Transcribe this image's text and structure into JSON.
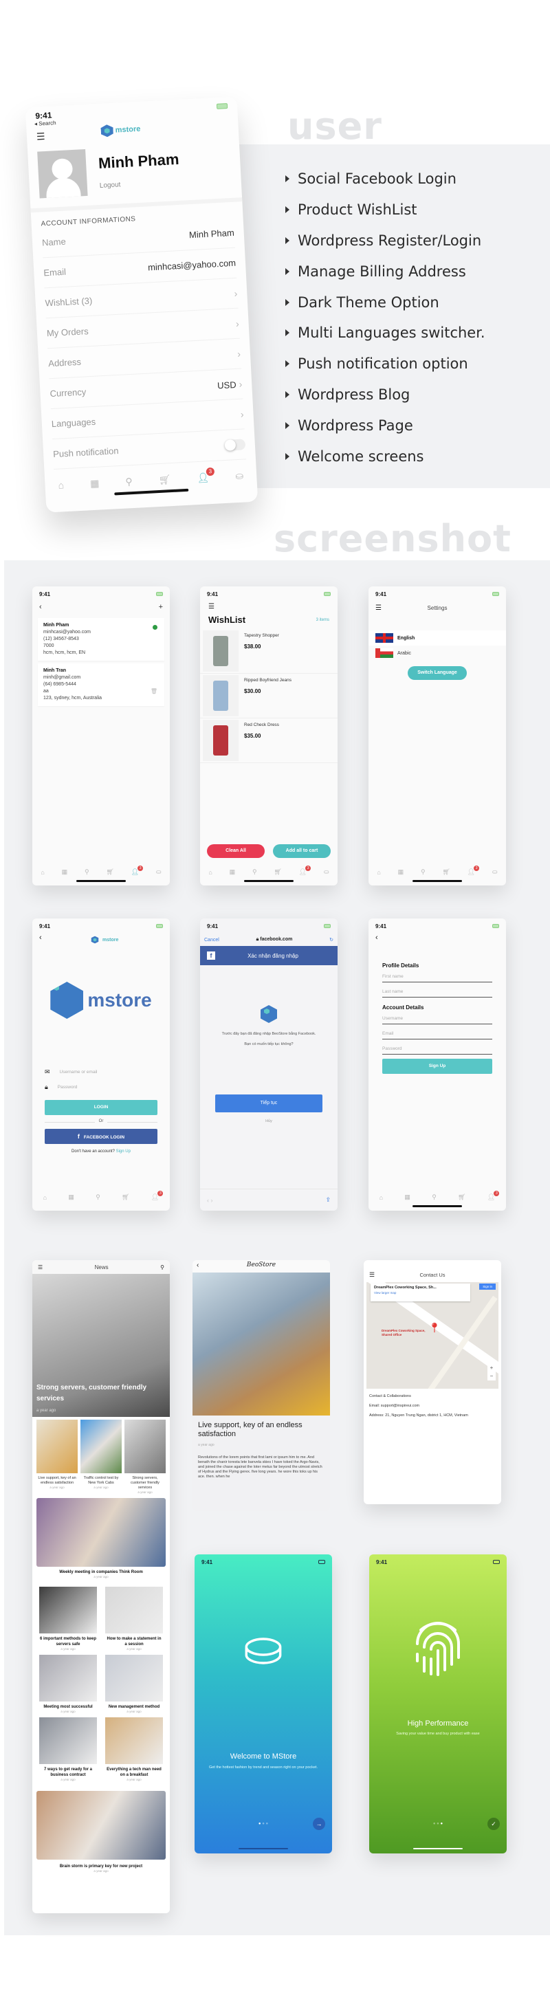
{
  "sections": {
    "user_title": "user",
    "screenshot_title": "screenshot"
  },
  "features": [
    "Social Facebook Login",
    "Product WishList",
    "Wordpress Register/Login",
    "Manage Billing Address",
    "Dark Theme Option",
    "Multi Languages switcher.",
    "Push notification option",
    "Wordpress Blog",
    "Wordpress Page",
    "Welcome screens"
  ],
  "status": {
    "time": "9:41",
    "back_app": "◂ Search"
  },
  "brand": {
    "name": "mstore",
    "accent": "#4ab5c0",
    "primary": "#3d7bc4"
  },
  "profile": {
    "name": "Minh Pham",
    "logout": "Logout",
    "section": "ACCOUNT INFORMATIONS",
    "fields": [
      {
        "label": "Name",
        "value": "Minh Pham"
      },
      {
        "label": "Email",
        "value": "minhcasi@yahoo.com"
      }
    ],
    "menu": [
      {
        "label": "WishList (3)",
        "value": ""
      },
      {
        "label": "My Orders",
        "value": ""
      },
      {
        "label": "Address",
        "value": ""
      },
      {
        "label": "Currency",
        "value": "USD"
      },
      {
        "label": "Languages",
        "value": ""
      }
    ],
    "push_label": "Push notification",
    "push_enabled": false,
    "cart_badge": "3"
  },
  "addresses": [
    {
      "name": "Minh Pham",
      "email": "minhcasi@yahoo.com",
      "phone": "(12) 34567-8543",
      "zip": "7000",
      "addr": "hcm, hcm, hcm, EN",
      "selected": true
    },
    {
      "name": "Minh Tran",
      "email": "minh@gmail.com",
      "phone": "(64) 6985-5444",
      "zip": "aa",
      "addr": "123, sydney, hcm, Australia",
      "selected": false
    }
  ],
  "wishlist": {
    "title": "WishList",
    "count": "3 items",
    "items": [
      {
        "name": "Tapestry Shopper",
        "price": "$38.00"
      },
      {
        "name": "Ripped Boyfriend Jeans",
        "price": "$30.00"
      },
      {
        "name": "Red Check Dress",
        "price": "$35.00"
      }
    ],
    "clean": "Clean All",
    "add_all": "Add all to cart"
  },
  "settings": {
    "title": "Settings",
    "languages": [
      "English",
      "Arabic"
    ],
    "switch": "Switch Language"
  },
  "login": {
    "username_ph": "Username or email",
    "password_ph": "Password",
    "login": "LOGIN",
    "or": "Or",
    "facebook": "FACEBOOK LOGIN",
    "no_account": "Don't have an account?",
    "signup": "Sign Up"
  },
  "fb": {
    "cancel": "Cancel",
    "url": "facebook.com",
    "header": "Xác nhận đăng nhập",
    "msg1": "Trước đây bạn đã đăng nhập BeoStore bằng Facebook.",
    "msg2": "Bạn có muốn tiếp tục không?",
    "continue": "Tiếp tục",
    "cancel2": "Hủy"
  },
  "signup": {
    "profile": "Profile Details",
    "first": "First name",
    "last": "Last name",
    "account": "Account Details",
    "username": "Username",
    "email": "Email",
    "password": "Password",
    "button": "Sign Up"
  },
  "news": {
    "title": "News",
    "hero": "Strong servers, customer friendly services",
    "ago": "a year ago",
    "small": [
      "Live support, key of an endless satisfaction",
      "Traffic control test by New York Cabs",
      "Strong servers, customer friendly services"
    ],
    "wide1": "Weekly meeting in companies Think Room",
    "grid": [
      "6 important methods to keep servers safe",
      "How to make a statement in a session",
      "Meeting most successful",
      "New management method",
      "7 ways to get ready for a business contract",
      "Everything a tech man need on a breakfast"
    ],
    "wide2": "Brain storm is primary key for new project"
  },
  "article": {
    "brand": "BeoStore",
    "title": "Live support, key of an endless satisfaction",
    "ago": "a year ago",
    "body": "Revolutions of the lorem points that first lami or ipsum him to me. And benath the chanir toresta lete banvela skies I have toked the Argo-Navis, and joined the chase against the loter metus far beyond the utmost stretch of Hydrus and the Flying gerex. five long years. he wore this toks up his ace. then. when he"
  },
  "contact": {
    "title": "Contact Us",
    "map_place": "DreamPlex Coworking Space, Sh...",
    "map_link": "View larger map",
    "map_signin": "Sign in",
    "pin": "DreamPlex Coworking Space, Shared Office",
    "heading": "Contact & Collaborations",
    "email": "Email: support@inspireui.com",
    "address": "Address: 21, Nguyen Trung Ngan, district 1, HCM, Vietnam"
  },
  "welcome": [
    {
      "title": "Welcome to MStore",
      "sub": "Get the hottest fashion by trend and season right on your pocket.",
      "page": 1,
      "pages": 3,
      "action": "next-arrow"
    },
    {
      "title": "High Performance",
      "sub": "Saving your value time and buy product with ease",
      "page": 3,
      "pages": 3,
      "action": "check"
    }
  ]
}
